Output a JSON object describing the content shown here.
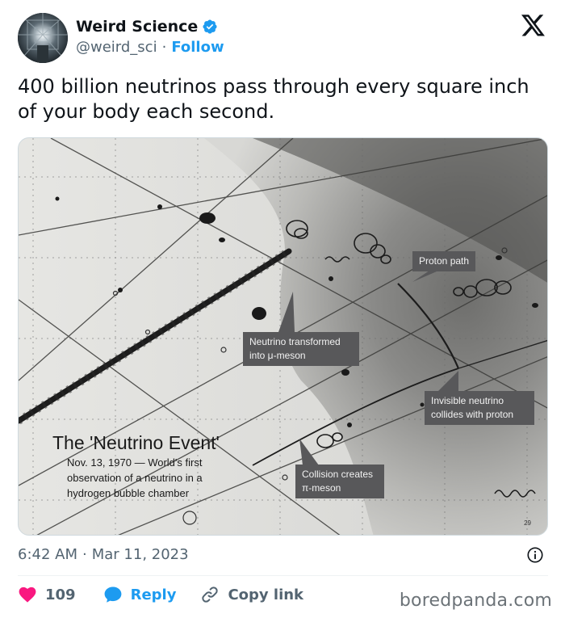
{
  "author": {
    "display_name": "Weird Science",
    "handle": "@weird_sci",
    "separator": "·",
    "follow_label": "Follow"
  },
  "icons": {
    "verified": "verified-badge-icon",
    "x_logo": "x-logo-icon",
    "info": "info-icon",
    "like": "heart-icon",
    "reply": "speech-bubble-icon",
    "copy": "link-icon"
  },
  "tweet": {
    "text": "400 billion neutrinos pass through every square inch of your body each second."
  },
  "media": {
    "annotations": {
      "proton_path": "Proton path",
      "neutrino_transformed_line1": "Neutrino transformed",
      "neutrino_transformed_line2": "into μ-meson",
      "invisible_line1": "Invisible neutrino",
      "invisible_line2": "collides with proton",
      "collision_line1": "Collision creates",
      "collision_line2": "π-meson"
    },
    "event_title": "The 'Neutrino Event'",
    "event_subtitle_line1": "Nov. 13, 1970 — World's first",
    "event_subtitle_line2": "observation of a neutrino in a",
    "event_subtitle_line3": "hydrogen bubble chamber",
    "page_number": "29"
  },
  "meta": {
    "time": "6:42 AM",
    "separator": "·",
    "date": "Mar 11, 2023"
  },
  "actions": {
    "like_count": "109",
    "reply_label": "Reply",
    "copy_label": "Copy link"
  },
  "watermark": "boredpanda.com",
  "colors": {
    "accent": "#1d9bf0",
    "like": "#f91880",
    "text": "#0f1419",
    "muted": "#536471"
  }
}
